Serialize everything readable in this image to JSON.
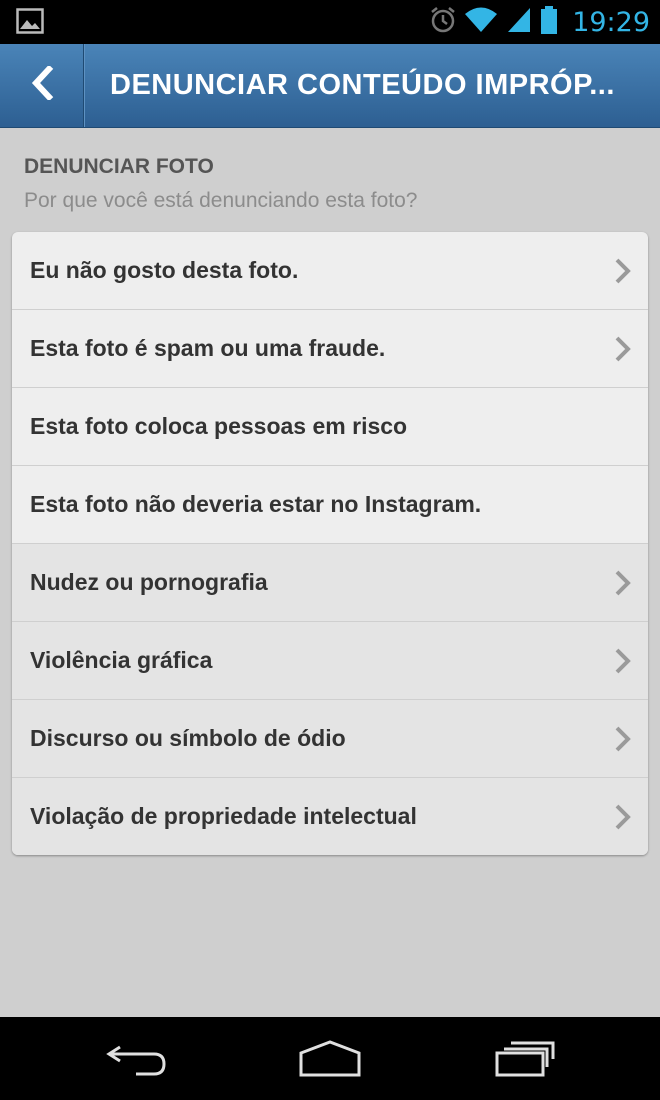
{
  "status_bar": {
    "time": "19:29",
    "icons": [
      "image-notification-icon",
      "alarm-icon",
      "wifi-icon",
      "signal-icon",
      "battery-icon"
    ],
    "accent_color": "#33b5e5"
  },
  "action_bar": {
    "title": "DENUNCIAR CONTEÚDO IMPRÓP...",
    "back_icon": "chevron-left-icon"
  },
  "header": {
    "title": "DENUNCIAR FOTO",
    "subtitle": "Por que você está denunciando esta foto?"
  },
  "list": {
    "items": [
      {
        "label": "Eu não gosto desta foto.",
        "has_chevron": true
      },
      {
        "label": "Esta foto é spam ou uma fraude.",
        "has_chevron": true
      },
      {
        "label": "Esta foto coloca pessoas em risco",
        "has_chevron": false
      },
      {
        "label": "Esta foto não deveria estar no Instagram.",
        "has_chevron": false
      },
      {
        "label": "Nudez ou pornografia",
        "has_chevron": true
      },
      {
        "label": "Violência gráfica",
        "has_chevron": true
      },
      {
        "label": "Discurso ou símbolo de ódio",
        "has_chevron": true
      },
      {
        "label": "Violação de propriedade intelectual",
        "has_chevron": true
      }
    ]
  },
  "nav_bar": {
    "icons": [
      "back-icon",
      "home-icon",
      "recent-apps-icon"
    ]
  }
}
